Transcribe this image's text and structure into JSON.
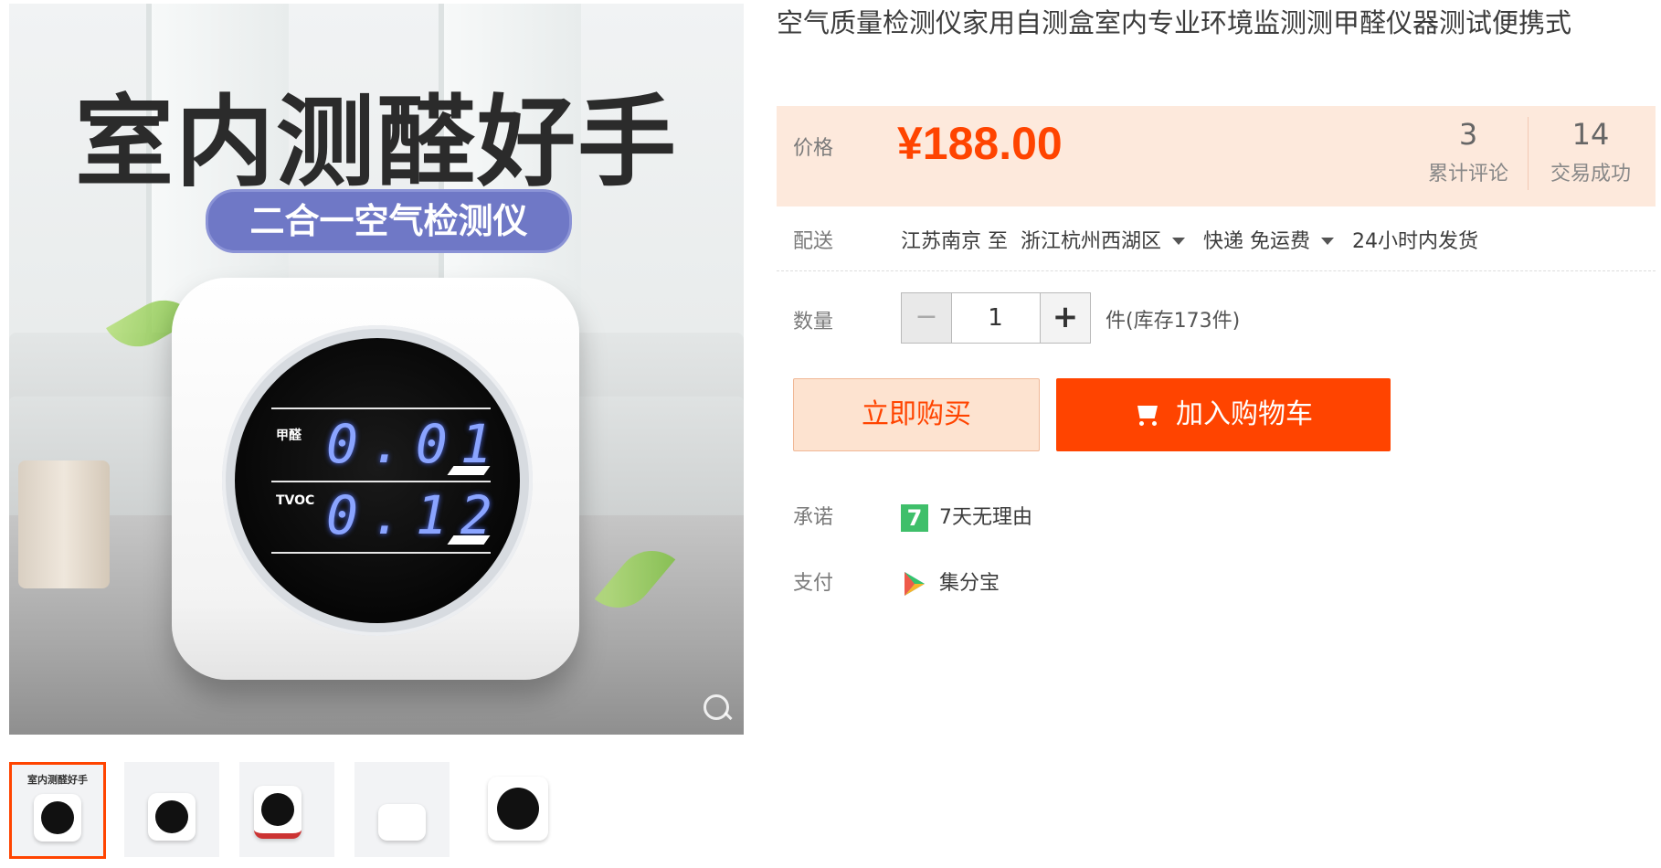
{
  "gallery": {
    "banner_title": "室内测醛好手",
    "banner_subtitle": "二合一空气检测仪",
    "screen": {
      "row1_label": "甲醛",
      "row1_value": "0.01",
      "row2_label": "TVOC",
      "row2_value": "0.12"
    },
    "thumbnails": [
      {
        "title": "室内测醛好手",
        "active": true
      },
      {
        "title": "",
        "active": false
      },
      {
        "title": "",
        "active": false
      },
      {
        "title": "",
        "active": false
      },
      {
        "title": "",
        "active": false
      }
    ]
  },
  "product": {
    "title": "空气质量检测仪家用自测盒室内专业环境监测测甲醛仪器测试便携式"
  },
  "price": {
    "label": "价格",
    "value": "¥188.00",
    "reviews_count": "3",
    "reviews_label": "累计评论",
    "sales_count": "14",
    "sales_label": "交易成功"
  },
  "delivery": {
    "label": "配送",
    "from": "江苏南京 至",
    "to": "浙江杭州西湖区",
    "method": "快递 免运费",
    "ship_time": "24小时内发货"
  },
  "quantity": {
    "label": "数量",
    "minus": "−",
    "value": "1",
    "plus": "+",
    "stock": "件(库存173件)"
  },
  "actions": {
    "buy_now": "立即购买",
    "add_to_cart": "加入购物车"
  },
  "promise": {
    "label": "承诺",
    "badge": "7",
    "text": "7天无理由"
  },
  "payment": {
    "label": "支付",
    "text": "集分宝"
  },
  "colors": {
    "accent": "#ff4400",
    "price_bg": "#fde9dc",
    "buy_bg": "#fde3d0"
  }
}
